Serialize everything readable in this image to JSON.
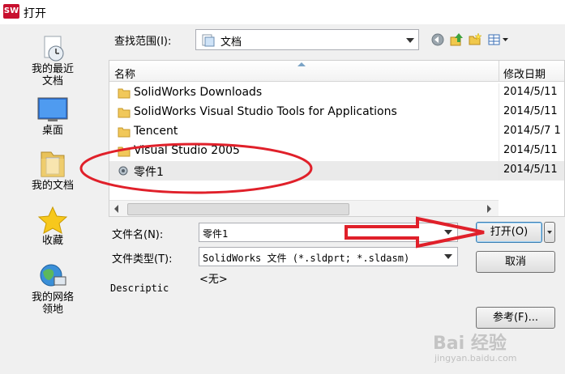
{
  "window": {
    "app_icon_text": "SW",
    "title": "打开"
  },
  "places": [
    {
      "label": "我的最近文档",
      "icon": "recent-documents-icon"
    },
    {
      "label": "桌面",
      "icon": "desktop-icon"
    },
    {
      "label": "我的文档",
      "icon": "my-documents-icon"
    },
    {
      "label": "收藏",
      "icon": "favorites-star-icon"
    },
    {
      "label": "我的网络领地",
      "icon": "network-places-icon"
    }
  ],
  "lookin": {
    "label": "查找范围(I):",
    "value": "文档",
    "icon": "documents-library-icon"
  },
  "toolbar": [
    "back-icon",
    "up-folder-icon",
    "new-folder-icon",
    "view-menu-icon"
  ],
  "filelist": {
    "columns": [
      "名称",
      "修改日期"
    ],
    "rows": [
      {
        "name": "SolidWorks Downloads",
        "date": "2014/5/11",
        "type": "folder"
      },
      {
        "name": "SolidWorks Visual Studio Tools for Applications",
        "date": "2014/5/11",
        "type": "folder"
      },
      {
        "name": "Tencent",
        "date": "2014/5/7 1",
        "type": "folder"
      },
      {
        "name": "Visual Studio 2005",
        "date": "2014/5/11",
        "type": "folder"
      },
      {
        "name": "零件1",
        "date": "2014/5/11",
        "type": "part",
        "selected": true
      }
    ]
  },
  "filename": {
    "label": "文件名(N):",
    "value": "零件1"
  },
  "filetype": {
    "label": "文件类型(T):",
    "value": "SolidWorks 文件 (*.sldprt; *.sldasm)"
  },
  "none_label": "<无>",
  "description_label": "Descriptic",
  "buttons": {
    "open": "打开(O)",
    "cancel": "取消",
    "reference": "参考(F)..."
  },
  "annotation_color": "#e0202a",
  "watermark": {
    "main": "Bai 经验",
    "sub": "jingyan.baidu.com"
  }
}
